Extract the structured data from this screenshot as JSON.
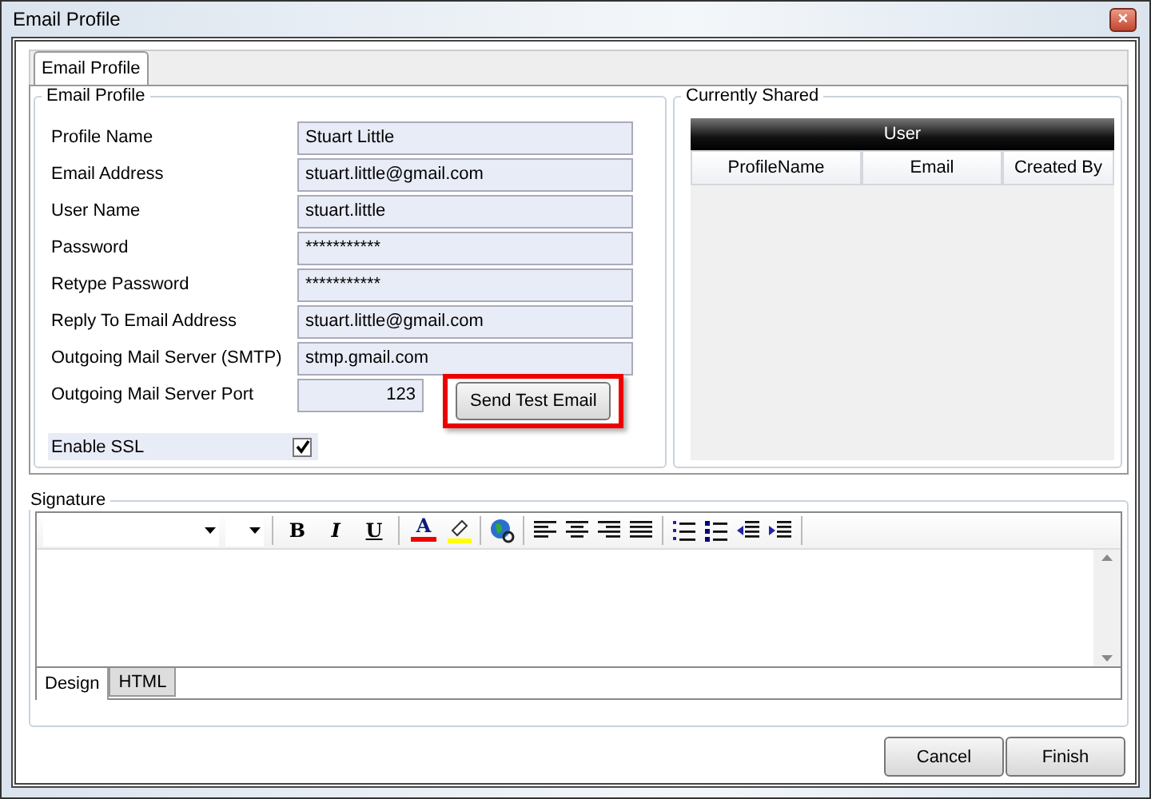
{
  "window": {
    "title": "Email Profile",
    "close": "×"
  },
  "tabs": [
    {
      "label": "Email Profile",
      "selected": true
    }
  ],
  "profile_group": {
    "title": "Email Profile",
    "fields": [
      {
        "label": "Profile Name",
        "value": "Stuart Little"
      },
      {
        "label": "Email Address",
        "value": "stuart.little@gmail.com"
      },
      {
        "label": "User Name",
        "value": "stuart.little"
      },
      {
        "label": "Password",
        "value": "***********"
      },
      {
        "label": "Retype Password",
        "value": "***********"
      },
      {
        "label": "Reply To Email Address",
        "value": "stuart.little@gmail.com"
      },
      {
        "label": "Outgoing Mail Server (SMTP)",
        "value": "stmp.gmail.com"
      },
      {
        "label": "Outgoing Mail Server Port",
        "value": "123",
        "kind": "port"
      }
    ],
    "ssl": {
      "label": "Enable SSL",
      "checked": true
    },
    "test_button": {
      "label": "Send Test Email",
      "highlighted": true
    }
  },
  "shared": {
    "title": "Currently Shared",
    "group_header": "User",
    "columns": [
      "ProfileName",
      "Email",
      "Created By"
    ]
  },
  "signature": {
    "title": "Signature",
    "format_buttons": [
      "B",
      "I",
      "U"
    ],
    "font_color": "A"
  },
  "editor_tabs": [
    {
      "label": "Design",
      "selected": true
    },
    {
      "label": "HTML",
      "selected": false
    }
  ],
  "buttons": [
    "Cancel",
    "Finish"
  ]
}
